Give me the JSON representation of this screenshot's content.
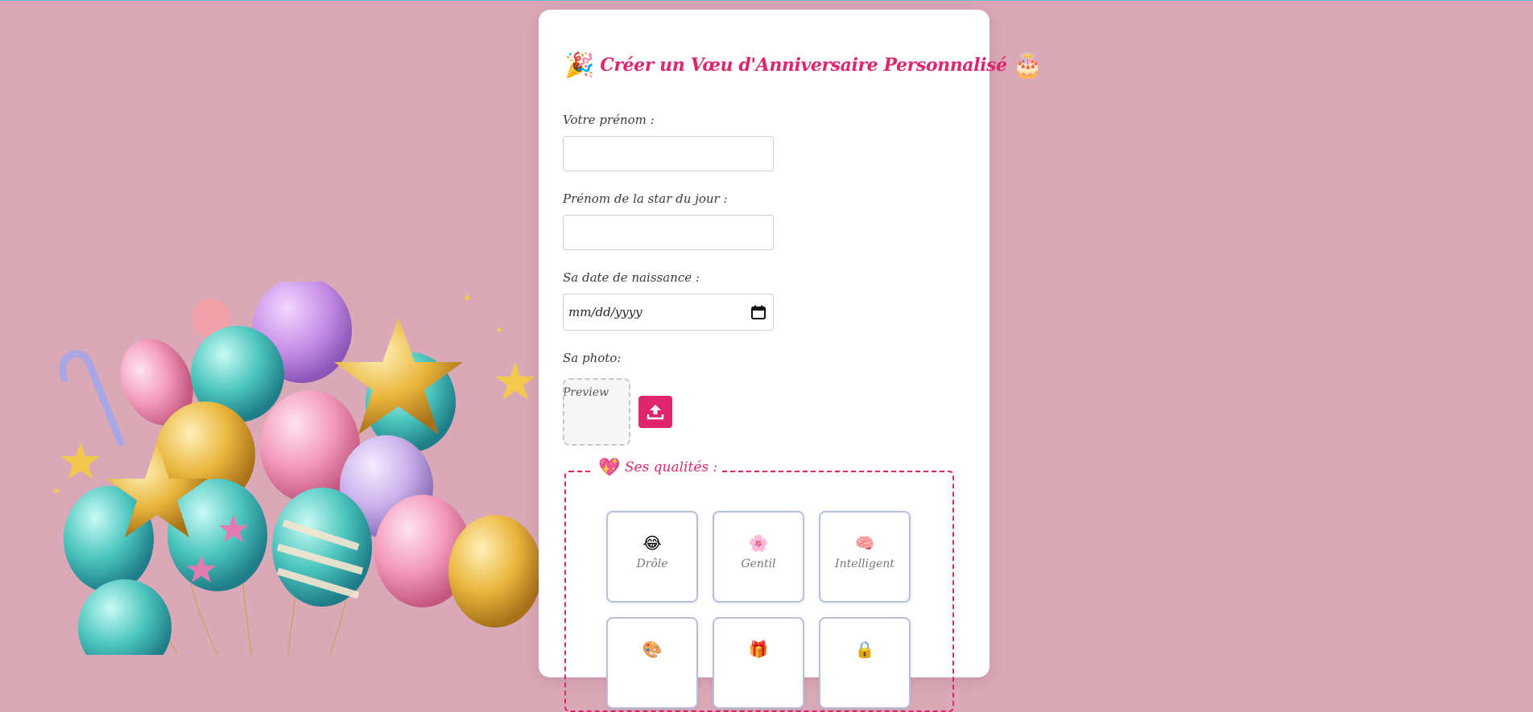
{
  "form": {
    "title": "Créer un Vœu d'Anniversaire Personnalisé",
    "title_emoji_left": "🎉",
    "title_emoji_right": "🎂",
    "your_name_label": "Votre prénom :",
    "your_name_value": "",
    "star_name_label": "Prénom de la star du jour :",
    "star_name_value": "",
    "birthdate_label": "Sa date de naissance :",
    "birthdate_placeholder": "mm/dd/yyyy",
    "photo_label": "Sa photo:",
    "photo_preview_alt": "Preview",
    "qualities_legend": "Ses qualités :",
    "qualities_legend_emoji": "💖",
    "qualities": [
      {
        "emoji": "😂",
        "label": "Drôle"
      },
      {
        "emoji": "🌸",
        "label": "Gentil"
      },
      {
        "emoji": "🧠",
        "label": "Intelligent"
      },
      {
        "emoji": "🎨",
        "label": ""
      },
      {
        "emoji": "🎁",
        "label": ""
      },
      {
        "emoji": "🔒",
        "label": ""
      }
    ]
  },
  "colors": {
    "background": "#d9a9b7",
    "accent": "#e0256e",
    "card_border": "#b9bde0"
  },
  "icons": {
    "upload": "upload-icon",
    "calendar": "calendar-icon"
  }
}
